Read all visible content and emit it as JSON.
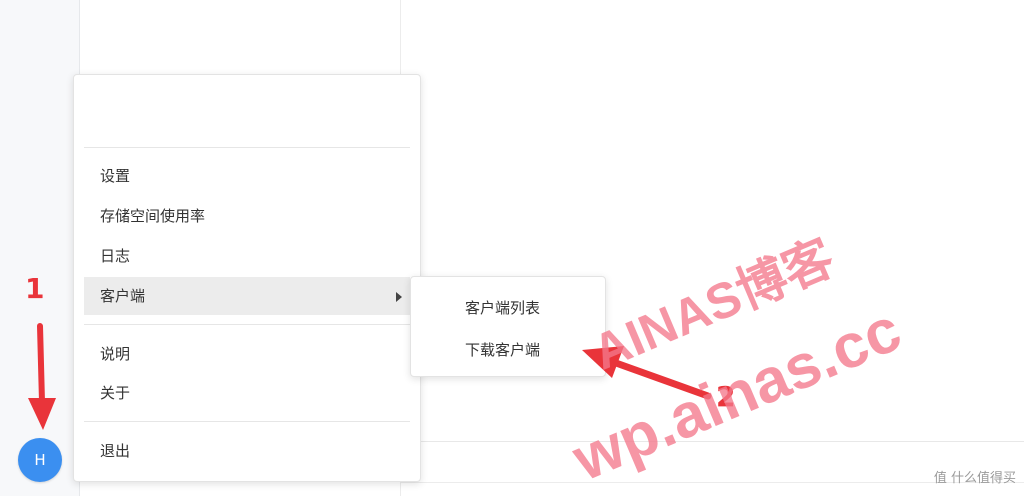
{
  "user": {
    "avatar_initial": "H"
  },
  "menu": {
    "items": [
      {
        "label": "设置"
      },
      {
        "label": "存储空间使用率"
      },
      {
        "label": "日志"
      },
      {
        "label": "客户端"
      },
      {
        "label": "说明"
      },
      {
        "label": "关于"
      },
      {
        "label": "退出"
      }
    ]
  },
  "submenu": {
    "items": [
      {
        "label": "客户端列表"
      },
      {
        "label": "下载客户端"
      }
    ]
  },
  "annotations": {
    "step1": "1",
    "step2": "2"
  },
  "watermark": {
    "line1": "AINAS博客",
    "line2": "wp.ainas.cc"
  },
  "footer": {
    "logo_text": "值 什么值得买"
  },
  "colors": {
    "accent": "#3b8ff0",
    "annotation": "#e9343a",
    "watermark": "#f4788c"
  }
}
